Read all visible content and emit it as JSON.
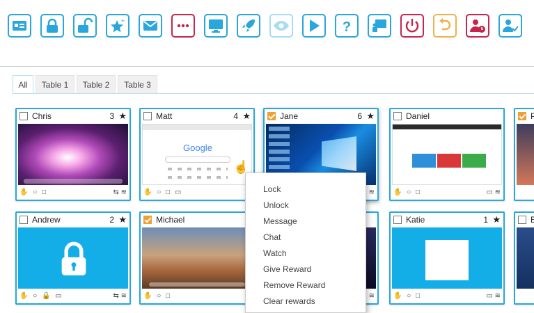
{
  "toolbar": {
    "buttons": [
      {
        "icon": "contact-card-icon"
      },
      {
        "icon": "lock-icon"
      },
      {
        "icon": "unlock-icon"
      },
      {
        "icon": "star-add-icon"
      },
      {
        "icon": "message-icon"
      },
      {
        "icon": "more-icon"
      },
      {
        "icon": "monitor-icon"
      },
      {
        "icon": "rocket-icon"
      },
      {
        "icon": "eye-icon"
      },
      {
        "icon": "play-icon"
      },
      {
        "icon": "question-icon"
      },
      {
        "icon": "presenter-icon"
      },
      {
        "icon": "power-icon"
      },
      {
        "icon": "undo-icon"
      },
      {
        "icon": "user-clock-icon"
      },
      {
        "icon": "user-check-icon"
      }
    ]
  },
  "tabs": [
    "All",
    "Table 1",
    "Table 2",
    "Table 3"
  ],
  "tiles": [
    {
      "name": "Chris",
      "count": "3",
      "checked": false
    },
    {
      "name": "Matt",
      "count": "4",
      "checked": false
    },
    {
      "name": "Jane",
      "count": "6",
      "checked": true
    },
    {
      "name": "Daniel",
      "count": "",
      "checked": false
    },
    {
      "name": "P",
      "count": "",
      "checked": true
    },
    {
      "name": "Andrew",
      "count": "2",
      "checked": false
    },
    {
      "name": "Michael",
      "count": "",
      "checked": true
    },
    {
      "name": "Katie",
      "count": "1",
      "checked": false
    },
    {
      "name": "E",
      "count": "",
      "checked": false
    }
  ],
  "google_text": "Google",
  "context_menu": [
    "Lock",
    "Unlock",
    "Message",
    "Chat",
    "Watch",
    "Give Reward",
    "Remove Reward",
    "Clear rewards"
  ],
  "colors": {
    "accent": "#29a6dc",
    "red": "#c7254e",
    "orange": "#f0b14a",
    "checked": "#f0a030"
  }
}
